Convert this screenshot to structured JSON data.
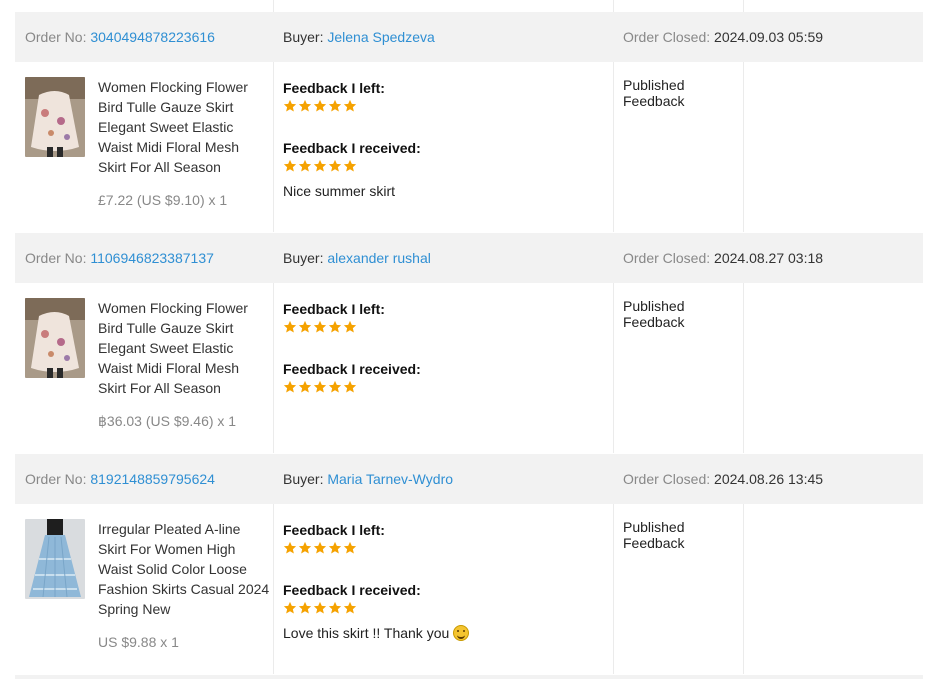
{
  "labels": {
    "order_no": "Order No:",
    "buyer": "Buyer:",
    "order_closed": "Order Closed:",
    "feedback_left": "Feedback I left:",
    "feedback_received": "Feedback I received:"
  },
  "colors": {
    "link": "#2f8fd3",
    "star": "#f5a200",
    "header_bg": "#f2f2f2"
  },
  "orders": [
    {
      "order_no": "3040494878223616",
      "buyer": "Jelena Spedzeva",
      "closed": "2024.09.03 05:59",
      "product_title": "Women Flocking Flower Bird Tulle Gauze Skirt Elegant Sweet Elastic Waist Midi Floral Mesh Skirt For All Season",
      "price": "£7.22 (US $9.10) x 1",
      "thumbnail": "floral-skirt-photo",
      "left_rating": 5,
      "received_rating": 5,
      "received_comment": "Nice summer skirt",
      "status": "Published Feedback"
    },
    {
      "order_no": "1106946823387137",
      "buyer": "alexander rushal",
      "closed": "2024.08.27 03:18",
      "product_title": "Women Flocking Flower Bird Tulle Gauze Skirt Elegant Sweet Elastic Waist Midi Floral Mesh Skirt For All Season",
      "price": "฿36.03 (US $9.46) x 1",
      "thumbnail": "floral-skirt-photo",
      "left_rating": 5,
      "received_rating": 5,
      "received_comment": "",
      "status": "Published Feedback"
    },
    {
      "order_no": "8192148859795624",
      "buyer": "Maria Tarnev-Wydro",
      "closed": "2024.08.26 13:45",
      "product_title": "Irregular Pleated A-line Skirt For Women High Waist Solid Color Loose Fashion Skirts Casual 2024 Spring New",
      "price": "US $9.88 x 1",
      "thumbnail": "blue-skirt-photo",
      "left_rating": 5,
      "received_rating": 5,
      "received_comment": "Love this skirt !! Thank you",
      "received_emoji": "smiling-face-icon",
      "status": "Published Feedback"
    }
  ]
}
